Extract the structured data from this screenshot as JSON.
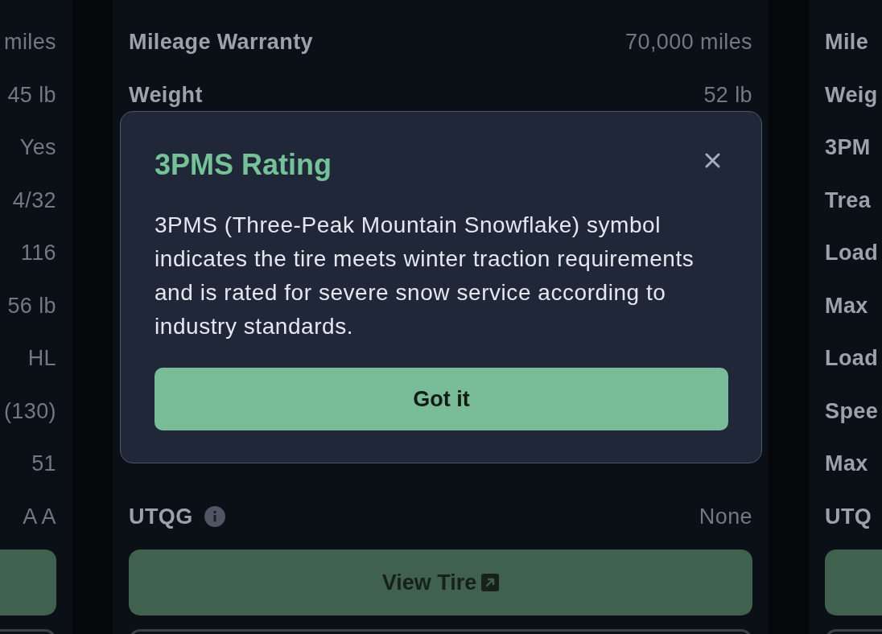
{
  "background": {
    "columns": [
      {
        "rows": [
          {
            "value": "miles"
          },
          {
            "value": "45 lb"
          },
          {
            "value": "Yes"
          },
          {
            "value": "4/32"
          },
          {
            "value": "116"
          },
          {
            "value": "56 lb"
          },
          {
            "value": "HL"
          },
          {
            "value": "(130)"
          },
          {
            "value": "51"
          },
          {
            "value": "A A"
          }
        ]
      },
      {
        "rows": [
          {
            "label": "Mileage Warranty",
            "value": "70,000 miles"
          },
          {
            "label": "Weight",
            "value": "52 lb"
          }
        ],
        "bottom_rows": [
          {
            "label": "UTQG",
            "info": true,
            "value": "None"
          }
        ],
        "button": {
          "label": "View Tire"
        }
      },
      {
        "rows": [
          {
            "label": "Mile"
          },
          {
            "label": "Weig"
          },
          {
            "label": "3PM"
          },
          {
            "label": "Trea"
          },
          {
            "label": "Load"
          },
          {
            "label": "Max"
          },
          {
            "label": "Load"
          },
          {
            "label": "Spee"
          },
          {
            "label": "Max"
          },
          {
            "label": "UTQ"
          }
        ]
      }
    ]
  },
  "dialog": {
    "title": "3PMS Rating",
    "body": "3PMS (Three-Peak Mountain Snowflake) symbol indicates the tire meets winter traction requirements and is rated for severe snow service according to industry standards.",
    "button": "Got it"
  }
}
